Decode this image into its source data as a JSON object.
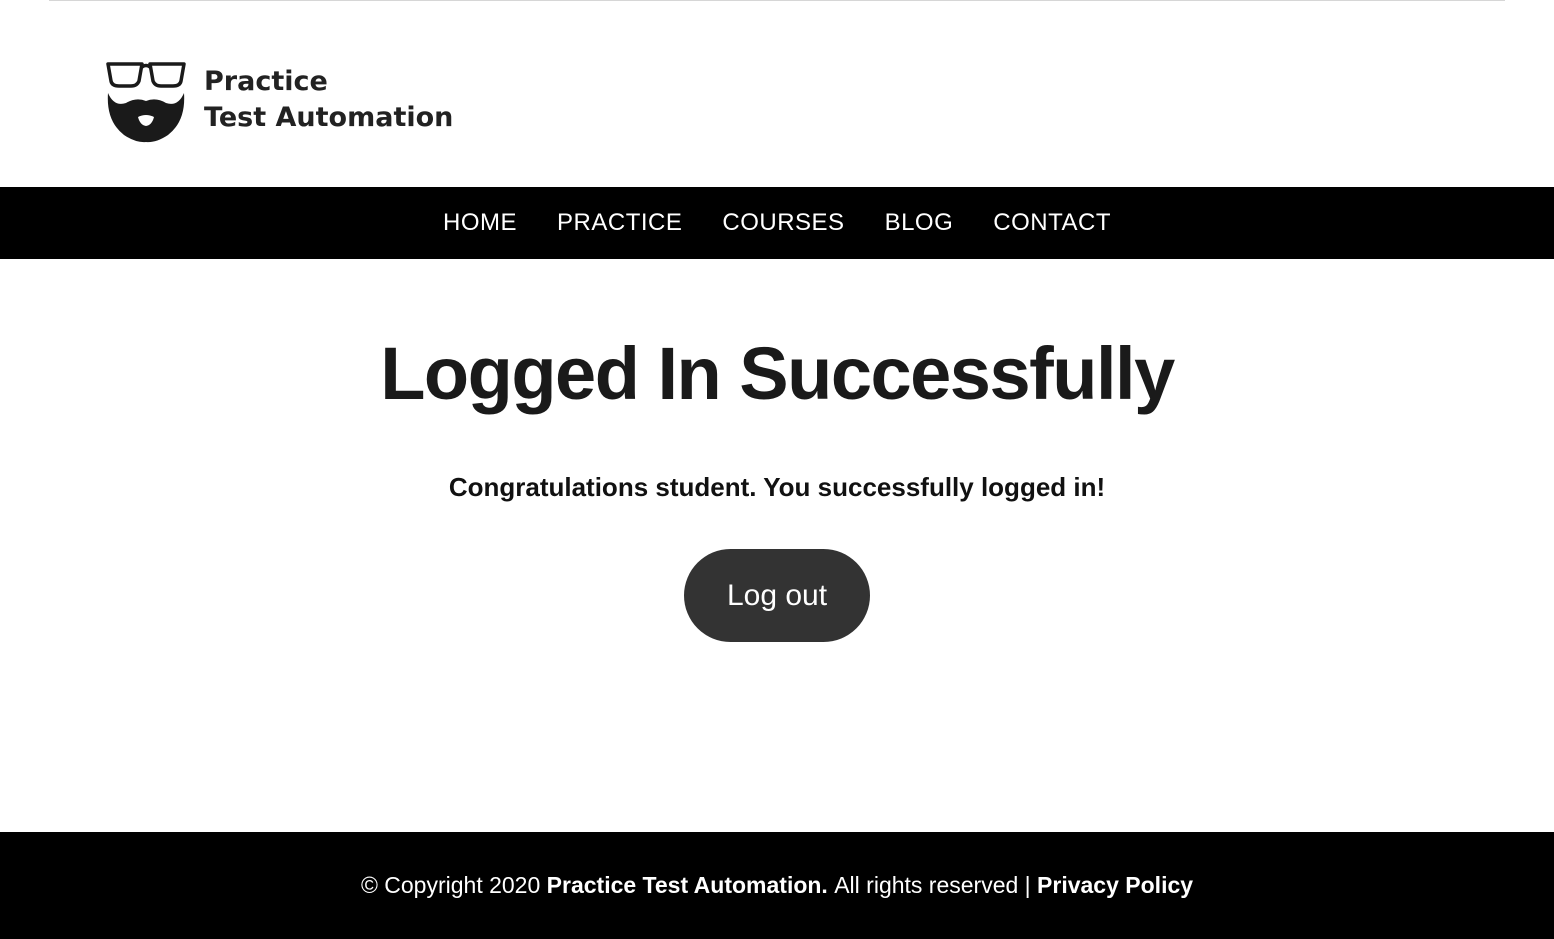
{
  "brand": {
    "line1": "Practice",
    "line2": "Test Automation",
    "logo_icon": "glasses-beard-icon"
  },
  "nav": {
    "items": [
      {
        "label": "HOME"
      },
      {
        "label": "PRACTICE"
      },
      {
        "label": "COURSES"
      },
      {
        "label": "BLOG"
      },
      {
        "label": "CONTACT"
      }
    ]
  },
  "main": {
    "title": "Logged In Successfully",
    "message": "Congratulations student. You successfully logged in!",
    "logout_label": "Log out"
  },
  "footer": {
    "copyright_prefix": "© Copyright 2020",
    "brand": "Practice Test Automation.",
    "rights": "All rights reserved |",
    "privacy_link": "Privacy Policy"
  },
  "colors": {
    "nav_background": "#000000",
    "footer_background": "#000000",
    "button_background": "#333333",
    "text_dark": "#1a1a1a"
  }
}
